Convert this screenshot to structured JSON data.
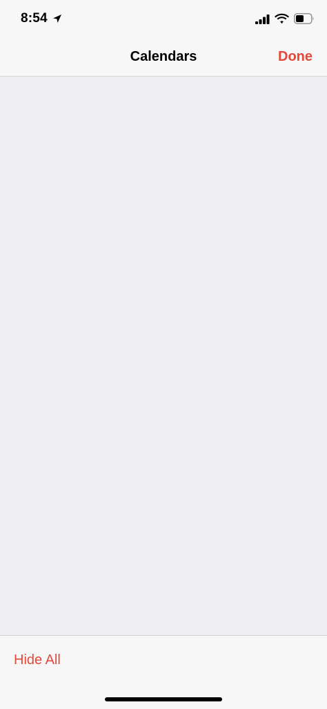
{
  "status_bar": {
    "time": "8:54",
    "icons": [
      "location-arrow-icon",
      "cellular-signal-icon",
      "wifi-icon",
      "battery-icon"
    ]
  },
  "nav": {
    "title": "Calendars",
    "done_label": "Done"
  },
  "toolbar": {
    "hide_all_label": "Hide All"
  },
  "colors": {
    "accent": "#e5483a",
    "bar_background": "#f7f7f7",
    "content_background": "#efeef3"
  }
}
